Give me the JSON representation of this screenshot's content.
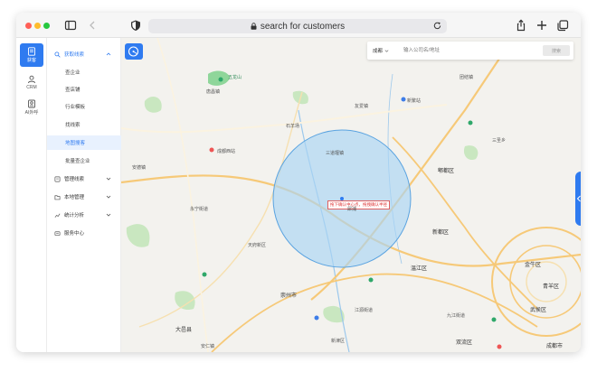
{
  "browser": {
    "url": "search for customers"
  },
  "rail": {
    "items": [
      {
        "label": "获客",
        "icon": "funnel-icon"
      },
      {
        "label": "CRM",
        "icon": "users-icon"
      },
      {
        "label": "AI外呼",
        "icon": "robot-icon"
      }
    ]
  },
  "menu": {
    "group_acquire": "获取线索",
    "sub_items": [
      "查企业",
      "查店铺",
      "行业模板",
      "找线索",
      "地图搜客",
      "批量查企业"
    ],
    "group_manage": "管理线索",
    "group_local": "本地管理",
    "group_stats": "统计分析",
    "group_service": "服务中心"
  },
  "map": {
    "city": "成都",
    "search_placeholder": "输入公司名/地址",
    "search_button": "搜索",
    "center_tip": "拖下确认中心点，拖拽确认半径",
    "labels": {
      "l1": "五龙山",
      "l2": "石羊场",
      "l3": "三道堰镇",
      "l4": "新繁站",
      "l5": "新都区",
      "l6": "郫都区",
      "l7": "安德镇",
      "l8": "犀浦",
      "l9": "友爱镇",
      "l10": "团结镇",
      "l11": "三圣乡",
      "l12": "崇州市",
      "l13": "温江区",
      "l14": "双流区",
      "l15": "成都市",
      "l16": "金牛区",
      "l17": "青羊区",
      "l18": "武侯区",
      "l19": "大邑县",
      "l20": "安仁镇",
      "l21": "新津区",
      "l22": "江源街道",
      "l23": "天府新区",
      "l24": "九江街道",
      "l25": "永宁街道",
      "l26": "唐昌镇",
      "l27": "成都西站"
    }
  },
  "colors": {
    "accent": "#2f7bf0",
    "circle_fill": "#a9d4f5",
    "circle_stroke": "#5aa3e0",
    "road": "#f6c978",
    "water": "#9cc8ec",
    "park": "#b8e0b0"
  }
}
